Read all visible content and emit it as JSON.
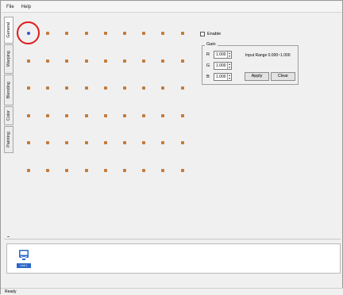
{
  "menu": {
    "file": "File",
    "help": "Help"
  },
  "tabs": [
    {
      "label": "General"
    },
    {
      "label": "Warping"
    },
    {
      "label": "Blending"
    },
    {
      "label": "Color"
    },
    {
      "label": "Painting"
    }
  ],
  "grid": {
    "rows": 6,
    "cols": 9,
    "selected_row": 0,
    "selected_col": 0
  },
  "enable": {
    "label": "Enable",
    "checked": false
  },
  "gain": {
    "legend": "Gain",
    "rows": [
      {
        "channel": "R",
        "value": "1.000"
      },
      {
        "channel": "G",
        "value": "1.000"
      },
      {
        "channel": "B",
        "value": "1.000"
      }
    ],
    "range_text": "Input Range 0.000~1.000",
    "apply_label": "Apply",
    "clear_label": "Clear"
  },
  "device": {
    "label": "Unit 1",
    "icon": "monitor-icon"
  },
  "status": {
    "text": "Ready"
  },
  "colors": {
    "dot": "#c27a3a",
    "selected_dot": "#3a52c8",
    "highlight": "#e01b1b",
    "device_accent": "#2a67c8"
  }
}
